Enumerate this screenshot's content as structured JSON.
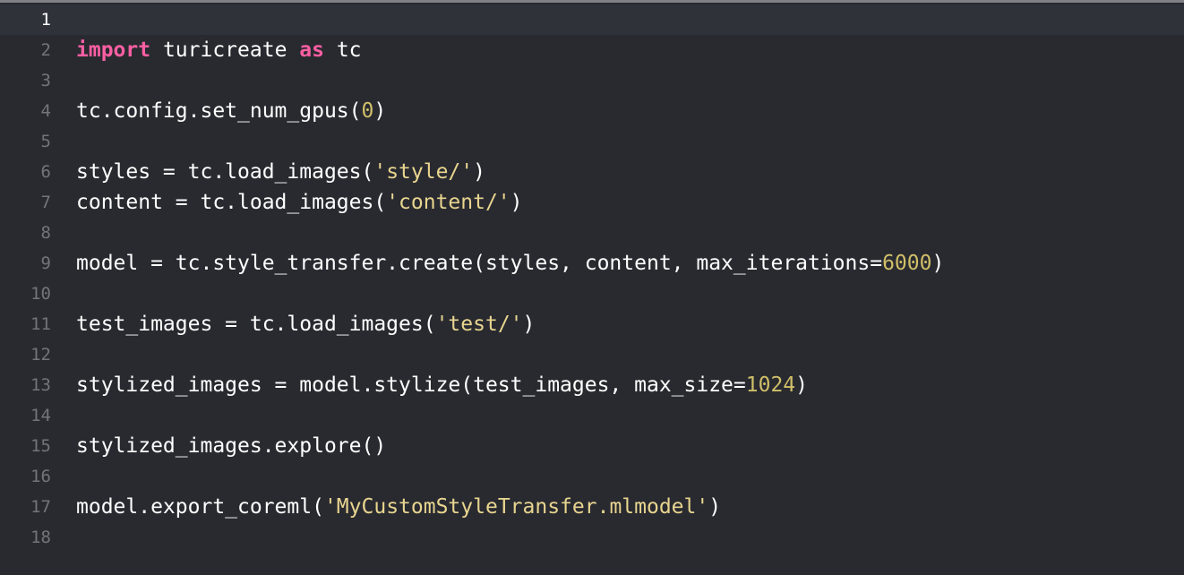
{
  "editor": {
    "colors": {
      "background": "#292a30",
      "current_line": "#2f3239",
      "keyword": "#fc5fa3",
      "string": "#e8d58f",
      "number": "#d0bf69",
      "plain": "#ffffff",
      "line_number": "#747478"
    },
    "current_line": 1,
    "lines": [
      {
        "n": "1",
        "tokens": []
      },
      {
        "n": "2",
        "tokens": [
          {
            "t": "kw",
            "s": "import"
          },
          {
            "t": "plain",
            "s": " turicreate "
          },
          {
            "t": "kw",
            "s": "as"
          },
          {
            "t": "plain",
            "s": " tc"
          }
        ]
      },
      {
        "n": "3",
        "tokens": []
      },
      {
        "n": "4",
        "tokens": [
          {
            "t": "plain",
            "s": "tc.config.set_num_gpus("
          },
          {
            "t": "num",
            "s": "0"
          },
          {
            "t": "plain",
            "s": ")"
          }
        ]
      },
      {
        "n": "5",
        "tokens": []
      },
      {
        "n": "6",
        "tokens": [
          {
            "t": "plain",
            "s": "styles = tc.load_images("
          },
          {
            "t": "str",
            "s": "'style/'"
          },
          {
            "t": "plain",
            "s": ")"
          }
        ]
      },
      {
        "n": "7",
        "tokens": [
          {
            "t": "plain",
            "s": "content = tc.load_images("
          },
          {
            "t": "str",
            "s": "'content/'"
          },
          {
            "t": "plain",
            "s": ")"
          }
        ]
      },
      {
        "n": "8",
        "tokens": []
      },
      {
        "n": "9",
        "tokens": [
          {
            "t": "plain",
            "s": "model = tc.style_transfer.create(styles, content, max_iterations="
          },
          {
            "t": "num",
            "s": "6000"
          },
          {
            "t": "plain",
            "s": ")"
          }
        ]
      },
      {
        "n": "10",
        "tokens": []
      },
      {
        "n": "11",
        "tokens": [
          {
            "t": "plain",
            "s": "test_images = tc.load_images("
          },
          {
            "t": "str",
            "s": "'test/'"
          },
          {
            "t": "plain",
            "s": ")"
          }
        ]
      },
      {
        "n": "12",
        "tokens": []
      },
      {
        "n": "13",
        "tokens": [
          {
            "t": "plain",
            "s": "stylized_images = model.stylize(test_images, max_size="
          },
          {
            "t": "num",
            "s": "1024"
          },
          {
            "t": "plain",
            "s": ")"
          }
        ]
      },
      {
        "n": "14",
        "tokens": []
      },
      {
        "n": "15",
        "tokens": [
          {
            "t": "plain",
            "s": "stylized_images.explore()"
          }
        ]
      },
      {
        "n": "16",
        "tokens": []
      },
      {
        "n": "17",
        "tokens": [
          {
            "t": "plain",
            "s": "model.export_coreml("
          },
          {
            "t": "str",
            "s": "'MyCustomStyleTransfer.mlmodel'"
          },
          {
            "t": "plain",
            "s": ")"
          }
        ]
      },
      {
        "n": "18",
        "tokens": []
      }
    ]
  }
}
